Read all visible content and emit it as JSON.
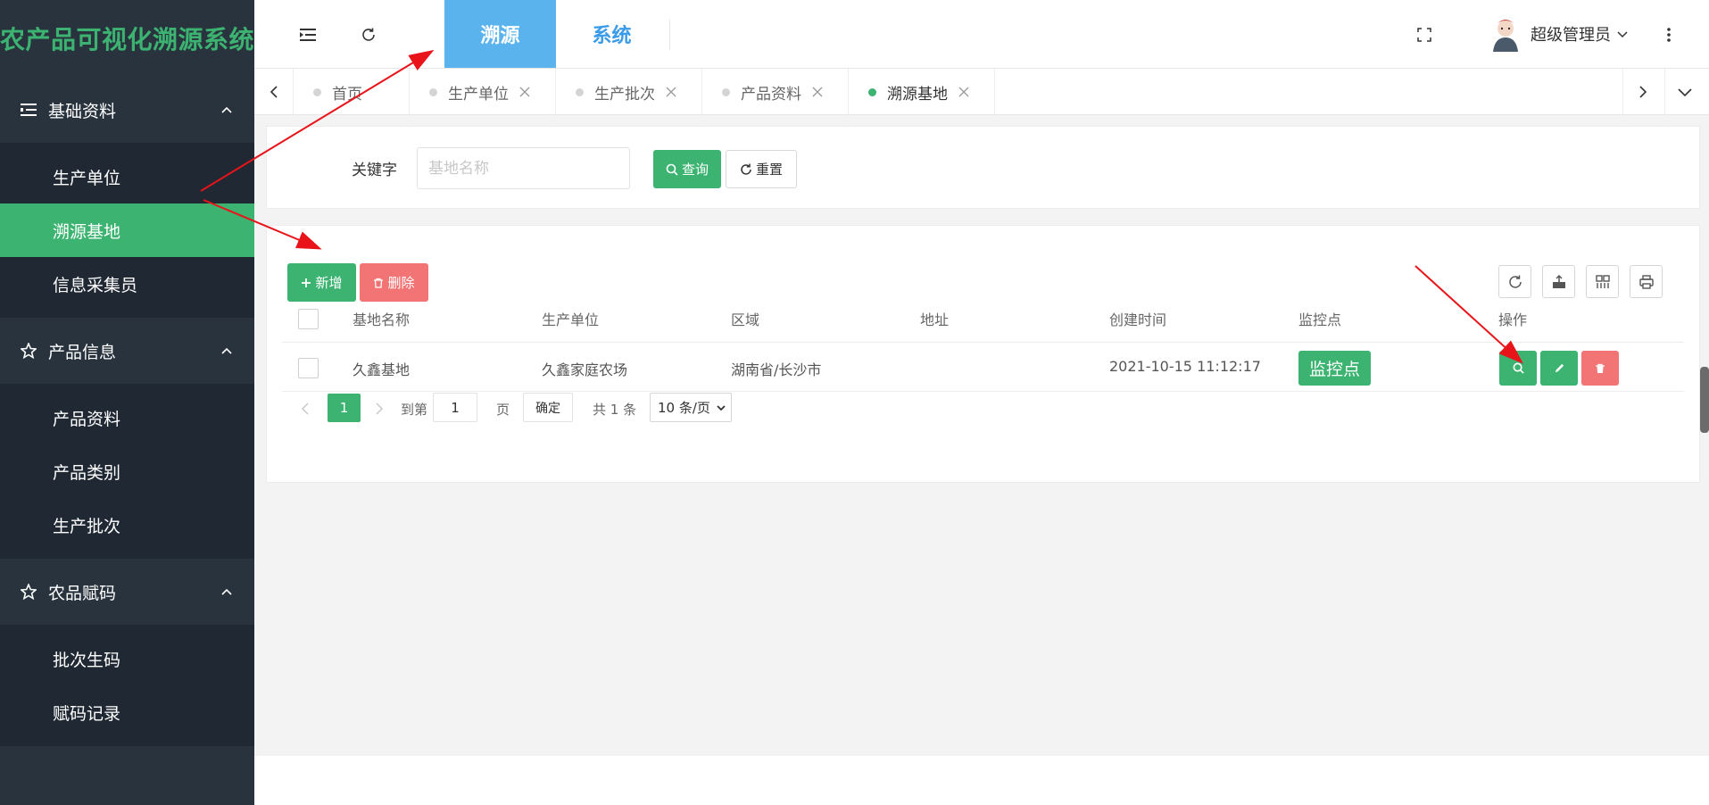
{
  "app": {
    "title": "农产品可视化溯源系统"
  },
  "sidebar": {
    "groups": [
      {
        "title": "基础资料",
        "items": [
          {
            "label": "生产单位",
            "active": false
          },
          {
            "label": "溯源基地",
            "active": true
          },
          {
            "label": "信息采集员",
            "active": false
          }
        ]
      },
      {
        "title": "产品信息",
        "items": [
          {
            "label": "产品资料"
          },
          {
            "label": "产品类别"
          },
          {
            "label": "生产批次"
          }
        ]
      },
      {
        "title": "农品赋码",
        "items": [
          {
            "label": "批次生码"
          },
          {
            "label": "赋码记录"
          }
        ]
      }
    ]
  },
  "header": {
    "tabs": [
      {
        "label": "溯源",
        "active": true
      },
      {
        "label": "系统",
        "active": false
      }
    ],
    "user_name": "超级管理员"
  },
  "page_tabs": [
    {
      "label": "首页",
      "active": false
    },
    {
      "label": "生产单位",
      "active": false
    },
    {
      "label": "生产批次",
      "active": false
    },
    {
      "label": "产品资料",
      "active": false
    },
    {
      "label": "溯源基地",
      "active": true
    }
  ],
  "search": {
    "label": "关键字",
    "placeholder": "基地名称",
    "query_label": "查询",
    "reset_label": "重置"
  },
  "toolbar": {
    "add_label": "新增",
    "delete_label": "删除"
  },
  "table": {
    "columns": [
      "基地名称",
      "生产单位",
      "区域",
      "地址",
      "创建时间",
      "监控点",
      "操作"
    ],
    "rows": [
      {
        "name": "久鑫基地",
        "unit": "久鑫家庭农场",
        "region": "湖南省/长沙市",
        "address": "",
        "created": "2021-10-15 11:12:17",
        "monitor_label": "监控点"
      }
    ]
  },
  "pagination": {
    "current": "1",
    "goto_label": "到第",
    "goto_value": "1",
    "page_label": "页",
    "confirm_label": "确定",
    "total_label": "共 1 条",
    "page_size": "10 条/页"
  },
  "colors": {
    "primary_green": "#3cb371",
    "danger_red": "#f27474",
    "sidebar_bg": "#28333e",
    "header_tab_active": "#5bb3ee",
    "annotation_arrow": "#e8141a"
  }
}
